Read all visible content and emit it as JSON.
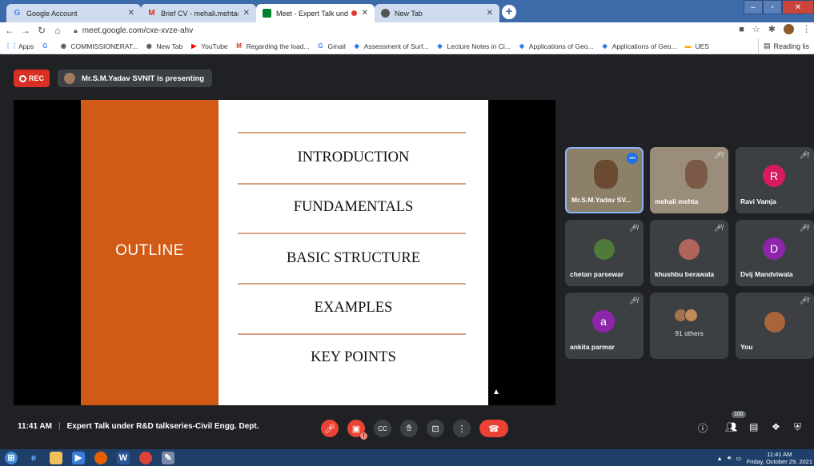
{
  "browser": {
    "tabs": [
      {
        "label": "Google Account",
        "icon": "google-icon"
      },
      {
        "label": "Brief CV - mehali.mehta@scet.ac",
        "icon": "gmail-icon"
      },
      {
        "label": "Meet - Expert Talk under R&",
        "icon": "meet-icon"
      },
      {
        "label": "New Tab",
        "icon": "chrome-icon"
      }
    ],
    "url": "meet.google.com/cxe-xvze-ahv",
    "bookmarks": [
      "Apps",
      "COMMISSIONERAT...",
      "New Tab",
      "YouTube",
      "Regarding the load...",
      "Gmail",
      "Assessment of Surf...",
      "Lecture Notes in Ci...",
      "Applications of Geo...",
      "Applications of Geo...",
      "UES"
    ],
    "reading_list": "Reading lis"
  },
  "meet": {
    "rec_label": "REC",
    "presenting": "Mr.S.M.Yadav SVNIT is presenting",
    "slide": {
      "left_title": "OUTLINE",
      "items": [
        "INTRODUCTION",
        "FUNDAMENTALS",
        "BASIC STRUCTURE",
        "EXAMPLES",
        "KEY POINTS"
      ]
    },
    "participants": [
      {
        "name": "Mr.S.M.Yadav SV...",
        "type": "video"
      },
      {
        "name": "mehali mehta",
        "type": "video"
      },
      {
        "name": "Ravi Vamja",
        "letter": "R",
        "color": "#d81b60"
      },
      {
        "name": "chetan parsewar",
        "type": "photo"
      },
      {
        "name": "khushbu berawala",
        "type": "photo"
      },
      {
        "name": "Dvij Mandviwala",
        "letter": "D",
        "color": "#8e24aa"
      },
      {
        "name": "ankita parmar",
        "letter": "a",
        "color": "#8e24aa"
      },
      {
        "name": "91 others",
        "type": "group"
      },
      {
        "name": "You",
        "type": "photo"
      }
    ],
    "time": "11:41 AM",
    "meeting_title": "Expert Talk under R&D talkseries-Civil Engg. Dept.",
    "participant_count": "100"
  },
  "taskbar": {
    "time": "11:41 AM",
    "date": "Friday, October 29, 2021"
  }
}
